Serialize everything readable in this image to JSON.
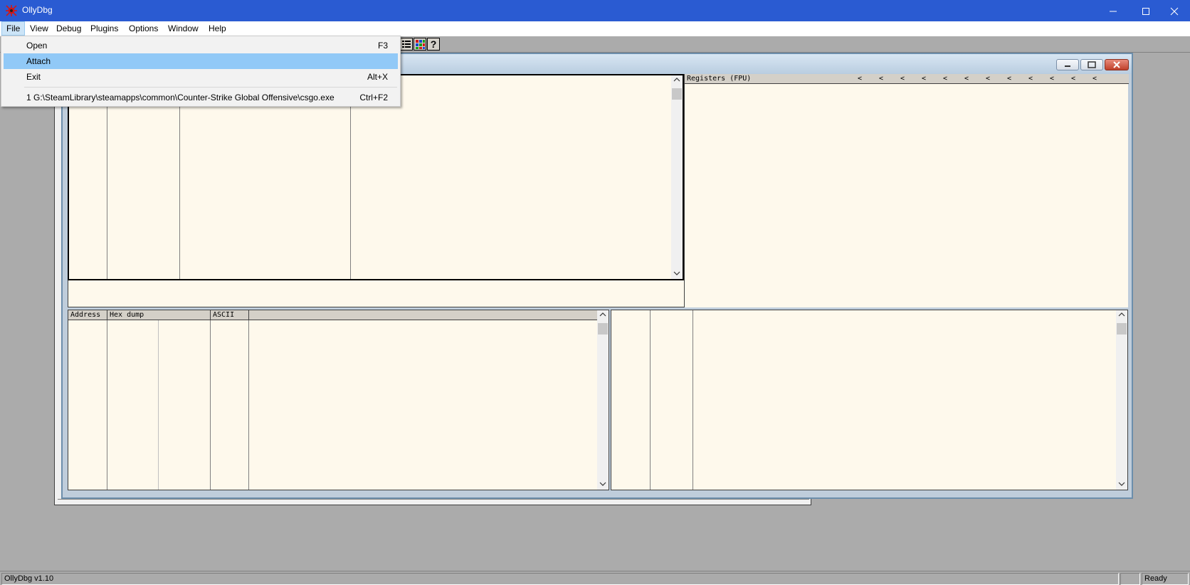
{
  "app": {
    "title": "OllyDbg",
    "icon": "ollydbg-bug-icon"
  },
  "window_controls": [
    "minimize-icon",
    "maximize-icon",
    "close-icon"
  ],
  "menubar": {
    "items": [
      {
        "label": "File"
      },
      {
        "label": "View"
      },
      {
        "label": "Debug"
      },
      {
        "label": "Plugins"
      },
      {
        "label": "Options"
      },
      {
        "label": "Window"
      },
      {
        "label": "Help"
      }
    ]
  },
  "file_menu": {
    "items": [
      {
        "label": "Open",
        "shortcut": "F3"
      },
      {
        "label": "Attach",
        "shortcut": ""
      },
      {
        "label": "Exit",
        "shortcut": "Alt+X"
      },
      {
        "label": "1 G:\\SteamLibrary\\steamapps\\common\\Counter-Strike Global Offensive\\csgo.exe",
        "shortcut": "Ctrl+F2"
      }
    ],
    "highlighted_item": "Attach"
  },
  "toolbar": {
    "visible_icons": [
      "list-icon",
      "grid-colors-icon",
      "help-icon"
    ],
    "help_glyph": "?"
  },
  "cpu_window": {
    "registers_header": "Registers (FPU)",
    "register_arrows": [
      "<",
      "<",
      "<",
      "<",
      "<",
      "<",
      "<",
      "<",
      "<",
      "<",
      "<",
      "<"
    ],
    "dump_headers": [
      "Address",
      "Hex dump",
      "ASCII"
    ],
    "scroll_up_glyph": "^",
    "scroll_down_glyph": "v"
  },
  "statusbar": {
    "left_text": "OllyDbg v1.10",
    "right_text": "Ready"
  },
  "colors": {
    "titlebar": "#2a5bd2",
    "pane_background": "#fef9ec",
    "menu_highlight": "#91c9f7",
    "desktop": "#ababab"
  }
}
